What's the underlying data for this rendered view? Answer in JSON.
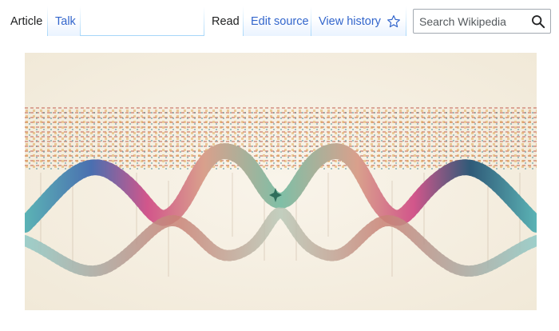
{
  "tabs": {
    "left": [
      {
        "label": "Article",
        "selected": true
      },
      {
        "label": "Talk",
        "selected": false
      }
    ],
    "right": [
      {
        "label": "Read",
        "selected": true
      },
      {
        "label": "Edit source",
        "selected": false
      },
      {
        "label": "View history",
        "selected": false
      }
    ],
    "watch_icon": "star-outline-icon"
  },
  "search": {
    "placeholder": "Search Wikipedia",
    "value": "",
    "icon": "magnifier-icon"
  },
  "colors": {
    "link": "#3366cc",
    "tab_border": "#a7d7f9",
    "text": "#202122",
    "image_background": "#f6f0e4"
  },
  "figure": {
    "description_icon": "dna-helix-illustration"
  }
}
